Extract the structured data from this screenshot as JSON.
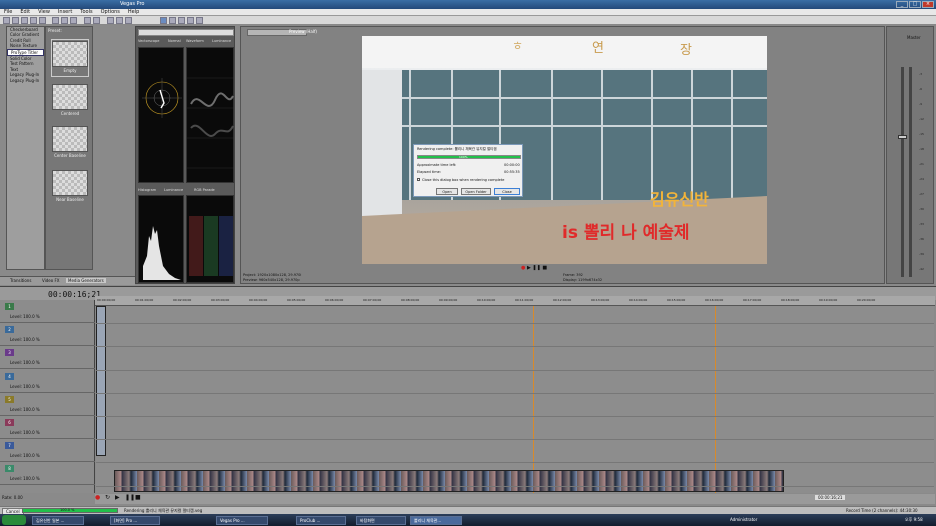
{
  "window": {
    "title": "Vegas Pro"
  },
  "menu": [
    "File",
    "Edit",
    "View",
    "Insert",
    "Tools",
    "Options",
    "Help"
  ],
  "plugins": [
    "Checkerboard",
    "Color Gradient",
    "Credit Roll",
    "Noise Texture",
    "ProType Titler",
    "Solid Color",
    "Test Pattern",
    "Text",
    "Legacy Plug-In",
    "Legacy Plug-In"
  ],
  "presets": {
    "header": "Preset:",
    "items": [
      "Empty",
      "Centered",
      "Center Baseline",
      "Near Baseline"
    ]
  },
  "scopes": {
    "top_tabs": [
      "Vectorscope",
      "Normal",
      "Waveform",
      "Luminance"
    ],
    "bottom_tabs": [
      "Histogram",
      "Luminance",
      "RGB Parade"
    ]
  },
  "left_tabs": [
    "Transitions",
    "Video FX",
    "Media Generators"
  ],
  "preview": {
    "mode": "Preview (Half)",
    "project": "1920x1080x128, 29.970i",
    "preview_label": "960x540x128, 29.970p",
    "frame": "392",
    "display": "1199x674x32",
    "labels": {
      "project": "Project:",
      "preview": "Preview:",
      "frame": "Frame:",
      "display": "Display:"
    }
  },
  "overlay": {
    "line1": "김유신반",
    "line2": "is 뽈리 나 예술제"
  },
  "dialog": {
    "title": "Rendering complete: 뽈리니 체육관 뮤지컬 멀티캠",
    "progress_pct": 100,
    "progress_label": "100%",
    "approx_label": "Approximate time left:",
    "approx_value": "00:00:00",
    "elapsed_label": "Elapsed time:",
    "elapsed_value": "00:55:35",
    "checkbox": "Close this dialog box when rendering complete",
    "buttons": [
      "Open",
      "Open Folder",
      "Close"
    ]
  },
  "timeline": {
    "time": "00:00:16;21",
    "marks": [
      "00:00:00;00",
      "00:01:00;00",
      "00:02:00;00",
      "00:03:00;00",
      "00:04:00;00",
      "00:05:00;00",
      "00:06:00;00",
      "00:07:00;00",
      "00:08:00;00",
      "00:09:00;00",
      "00:10:00;00",
      "00:11:00;00",
      "00:12:00;00",
      "00:13:00;00",
      "00:14:00;00",
      "00:15:00;00",
      "00:16:00;00",
      "00:17:00;00",
      "00:18:00;00",
      "00:19:00;00",
      "00:20:00;00"
    ],
    "tracks": [
      {
        "num": "1",
        "level": "Level: 100.0 %"
      },
      {
        "num": "2",
        "level": "Level: 100.0 %"
      },
      {
        "num": "3",
        "level": "Level: 100.0 %"
      },
      {
        "num": "4",
        "level": "Level: 100.0 %"
      },
      {
        "num": "5",
        "level": "Level: 100.0 %"
      },
      {
        "num": "6",
        "level": "Level: 100.0 %"
      },
      {
        "num": "7",
        "level": "Level: 100.0 %"
      },
      {
        "num": "8",
        "level": "Level: 100.0 %"
      }
    ],
    "rate": "Rate: 0.00",
    "end_time": "00:00:16;21"
  },
  "status": {
    "cancel": "Cancel",
    "progress_pct": 100,
    "progress_label": "100.0 %",
    "message": "Rendering 뽈리니 체육관 뮤지컬 멀티캠.veg",
    "record": "Record Time (2 channels): 44:30:30"
  },
  "mixer": {
    "title": "Master"
  },
  "taskbar": {
    "items": [
      "김유신반 일본 ...",
      "[화면] Pro ...",
      "ProClub ...",
      "Vegas Pro ...",
      "바탕화면",
      "뽈리니 체육관...",
      "뽈리니 체육관..."
    ],
    "user": "Administrator",
    "clock": "오후 9:58"
  },
  "colors": {
    "progress": "#22c04a",
    "overlay_line1": "#f2b43a",
    "overlay_line2": "#e02a2a"
  }
}
